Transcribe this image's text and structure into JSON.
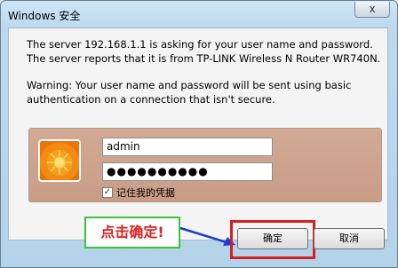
{
  "window": {
    "title": "Windows 安全",
    "close_glyph": "x"
  },
  "message": {
    "line1": "The server 192.168.1.1 is asking for your user name and password. The server reports that it is from TP-LINK Wireless N Router WR740N.",
    "line2": "Warning: Your user name and password will be sent using basic authentication on a connection that isn't secure."
  },
  "credentials": {
    "username": "admin",
    "password_mask": "●●●●●●●●●●",
    "remember_checked": true,
    "remember_label": "记住我的凭据"
  },
  "buttons": {
    "ok": "确定",
    "cancel": "取消"
  },
  "annotation": {
    "text": "点击确定!"
  },
  "colors": {
    "callout_border": "#3ac43a",
    "callout_text": "#e02020",
    "highlight": "#d81e1e",
    "arrow": "#1a3bd6"
  }
}
